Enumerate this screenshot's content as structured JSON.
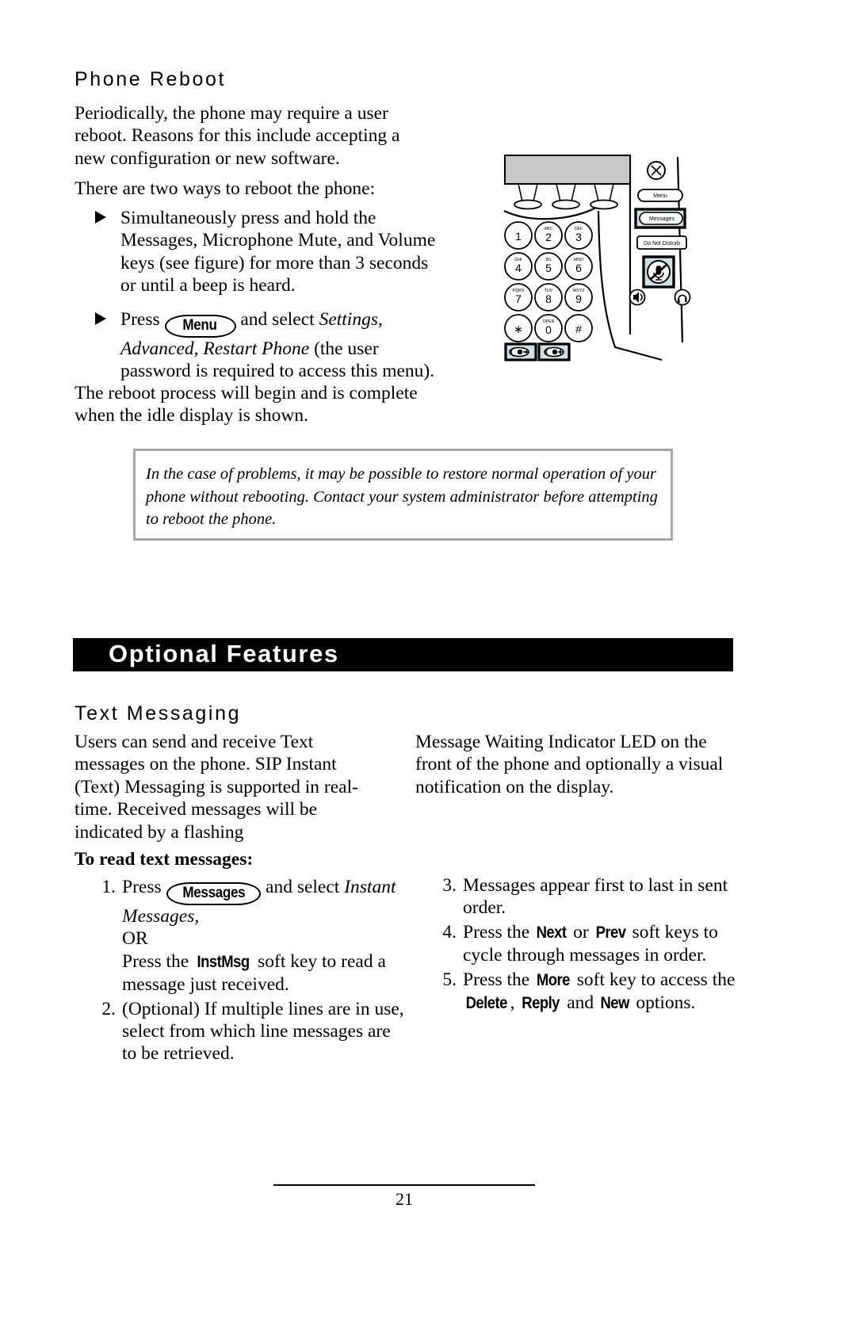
{
  "page": {
    "number": "21"
  },
  "phone_reboot": {
    "heading": "Phone Reboot",
    "intro": "Periodically, the phone may require a user reboot.  Reasons for this include accepting a new configuration or new software.",
    "ways_intro": "There are two ways to reboot the phone:",
    "bullets": [
      {
        "text": "Simultaneously press and hold the Messages, Microphone Mute, and Volume keys (see figure) for more than 3 seconds or until a beep is heard."
      },
      {
        "prefix": "Press",
        "key_label": "Menu",
        "mid": "and select",
        "italic": "Settings, Advanced, Restart Phone",
        "suffix": "(the user password is required to access this menu)."
      }
    ],
    "complete": "The reboot process will begin and is complete when the idle display is shown."
  },
  "note": {
    "text": "In the case of problems, it may be possible to restore normal operation of your phone without rebooting.  Contact your system administrator before attempting to reboot the phone."
  },
  "banner": {
    "label": "Optional Features"
  },
  "text_messaging": {
    "heading": "Text Messaging",
    "col_left": "Users can send and receive Text messages on the phone.  SIP Instant (Text) Messaging is supported in real-time.  Received messages will be indicated by a flashing",
    "col_right": "Message Waiting Indicator LED on the front of the phone and optionally a visual notification on the display.",
    "to_read_heading": "To read text messages:",
    "steps_left": [
      {
        "num": "1.",
        "prefix": "Press",
        "key_label": "Messages",
        "mid": "and select",
        "italic": "Instant Messages,",
        "or": "OR",
        "tail_prefix": "Press the",
        "softkey": "InstMsg",
        "tail_suffix": "soft key to read a message just received."
      },
      {
        "num": "2.",
        "text": "(Optional)  If multiple lines are in use, select from which line messages are to be retrieved."
      }
    ],
    "steps_right": [
      {
        "num": "3.",
        "text": "Messages appear first to last in sent order."
      },
      {
        "num": "4.",
        "prefix": "Press the",
        "key_a": "Next",
        "joiner": "or",
        "key_b": "Prev",
        "suffix": "soft keys to cycle through messages in order."
      },
      {
        "num": "5.",
        "prefix": "Press the",
        "key_a": "More",
        "mid": "soft key to access the",
        "opt_a": "Delete",
        "opt_sep": ",",
        "opt_b": "Reply",
        "opt_joiner": "and",
        "opt_c": "New",
        "suffix": "options."
      }
    ]
  },
  "figure": {
    "name": "ip-phone-keypad-diagram",
    "keypad": [
      {
        "digit": "1",
        "letters": ""
      },
      {
        "digit": "2",
        "letters": "ABC"
      },
      {
        "digit": "3",
        "letters": "DEF"
      },
      {
        "digit": "4",
        "letters": "GHI"
      },
      {
        "digit": "5",
        "letters": "JKL"
      },
      {
        "digit": "6",
        "letters": "MNO"
      },
      {
        "digit": "7",
        "letters": "PQRS"
      },
      {
        "digit": "8",
        "letters": "TUV"
      },
      {
        "digit": "9",
        "letters": "WXYZ"
      },
      {
        "digit": "∗",
        "letters": ""
      },
      {
        "digit": "0",
        "letters": "OPER"
      },
      {
        "digit": "#",
        "letters": ""
      }
    ],
    "side_keys": [
      {
        "label": "Menu",
        "highlighted": false
      },
      {
        "label": "Messages",
        "highlighted": true
      },
      {
        "label": "Do Not Disturb",
        "highlighted": true
      }
    ],
    "highlight_fill": "#cfe0e4",
    "display_fill": "#c8c8c8"
  }
}
